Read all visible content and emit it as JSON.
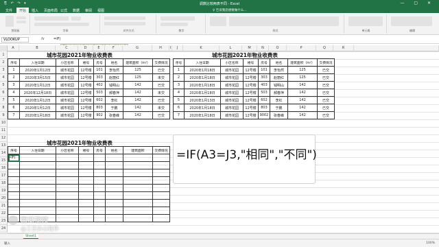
{
  "window": {
    "title": "调数比较两表不同 - Excel",
    "quick_access": "⎘ ↶ ↷ ▾",
    "controls": "— ▢ ✕"
  },
  "ribbon": {
    "tabs": [
      "文件",
      "开始",
      "插入",
      "页面布局",
      "公式",
      "数据",
      "审阅",
      "视图"
    ],
    "active_tab": "开始",
    "tell_me": "♀ 告诉我您想要做什么…",
    "groups": [
      "剪贴板",
      "字体",
      "对齐方式",
      "数字",
      "样式",
      "单元格",
      "编辑"
    ]
  },
  "formula_bar": {
    "name_box": "VLOOKUP",
    "fx": "fx",
    "content": "=IF(",
    "tooltip": "IF(logical_test, [value_if_true], [value_if_false])"
  },
  "columns_left": [
    "A",
    "B",
    "C",
    "D",
    "E",
    "F",
    "G",
    "H"
  ],
  "columns_right": [
    "I",
    "J",
    "K",
    "L",
    "M",
    "N",
    "O",
    "P",
    "Q",
    "R"
  ],
  "row_numbers": [
    "1",
    "2",
    "3",
    "4",
    "5",
    "6",
    "7",
    "8",
    "9",
    "10",
    "11",
    "12",
    "13",
    "14",
    "15",
    "16",
    "17",
    "18",
    "19",
    "20",
    "21",
    "22",
    "23",
    "24"
  ],
  "table_a": {
    "title": "城市花园2021年物业收费表",
    "headers": [
      "序号",
      "入住日期",
      "小区名称",
      "楼号",
      "房号",
      "姓名",
      "建筑面积（m²）",
      "交费情况"
    ],
    "rows": [
      [
        "1",
        "2020年1月12日",
        "城市花园",
        "12号楼",
        "101",
        "李怡然",
        "125",
        "已交"
      ],
      [
        "2",
        "2020年3月15日",
        "城市花园",
        "12号楼",
        "303",
        "赵丽红",
        "125",
        "未交"
      ],
      [
        "3",
        "2020年1月12日",
        "城市花园",
        "12号楼",
        "402",
        "钱明山",
        "142",
        "已交"
      ],
      [
        "4",
        "2020年12月18日",
        "城市花园",
        "12号楼",
        "503",
        "郝春萍",
        "142",
        "未交"
      ],
      [
        "5",
        "2020年1月12日",
        "城市花园",
        "12号楼",
        "602",
        "李红",
        "142",
        "已交"
      ],
      [
        "6",
        "2020年1月12日",
        "城市花园",
        "12号楼",
        "803",
        "于鹏",
        "142",
        "未交"
      ],
      [
        "7",
        "2020年1月18日",
        "城市花园",
        "12号楼",
        "902",
        "张春峰",
        "142",
        "已交"
      ]
    ]
  },
  "table_b": {
    "title": "城市花园2021年物业收费表",
    "headers": [
      "序号",
      "入住日期",
      "小区名称",
      "楼号",
      "房号",
      "姓名",
      "建筑面积（m²）",
      "交费情况"
    ],
    "rows": [
      [
        "1",
        "2020年1月18日",
        "城市花园",
        "12号楼",
        "101",
        "李怡然",
        "125",
        "已交"
      ],
      [
        "2",
        "2020年1月18日",
        "城市花园",
        "12号楼",
        "303",
        "赵丽红",
        "125",
        "已交"
      ],
      [
        "3",
        "2020年1月18日",
        "城市花园",
        "12号楼",
        "403",
        "钱明山",
        "142",
        "已交"
      ],
      [
        "4",
        "2020年1月18日",
        "城市花园",
        "12号楼",
        "503",
        "郝春萍",
        "142",
        "已交"
      ],
      [
        "5",
        "2020年1月13日",
        "城市花园",
        "12号楼",
        "602",
        "李红",
        "142",
        "已交"
      ],
      [
        "6",
        "2020年1月18日",
        "城市花园",
        "12号楼",
        "803",
        "于鹏",
        "142",
        "已交"
      ],
      [
        "7",
        "2020年1月18日",
        "城市花园",
        "12号楼",
        "9002",
        "张春峰",
        "142",
        "已交"
      ]
    ]
  },
  "table_c": {
    "title": "城市花园2021年物业收费表",
    "headers": [
      "序号",
      "入住日期",
      "小区名称",
      "楼号",
      "房号",
      "姓名",
      "建筑面积",
      "交费情况"
    ],
    "active_cell_text": "=IF(",
    "empty_rows": 9
  },
  "formula_display": "=IF(A3=J3,\"相同\",\"不同\")",
  "sheet_tab": "Sheet1",
  "status": {
    "mode": "输入",
    "zoom": "100%"
  },
  "watermark": {
    "line1": "西瓜视频",
    "line2": "@三日办公软件"
  }
}
